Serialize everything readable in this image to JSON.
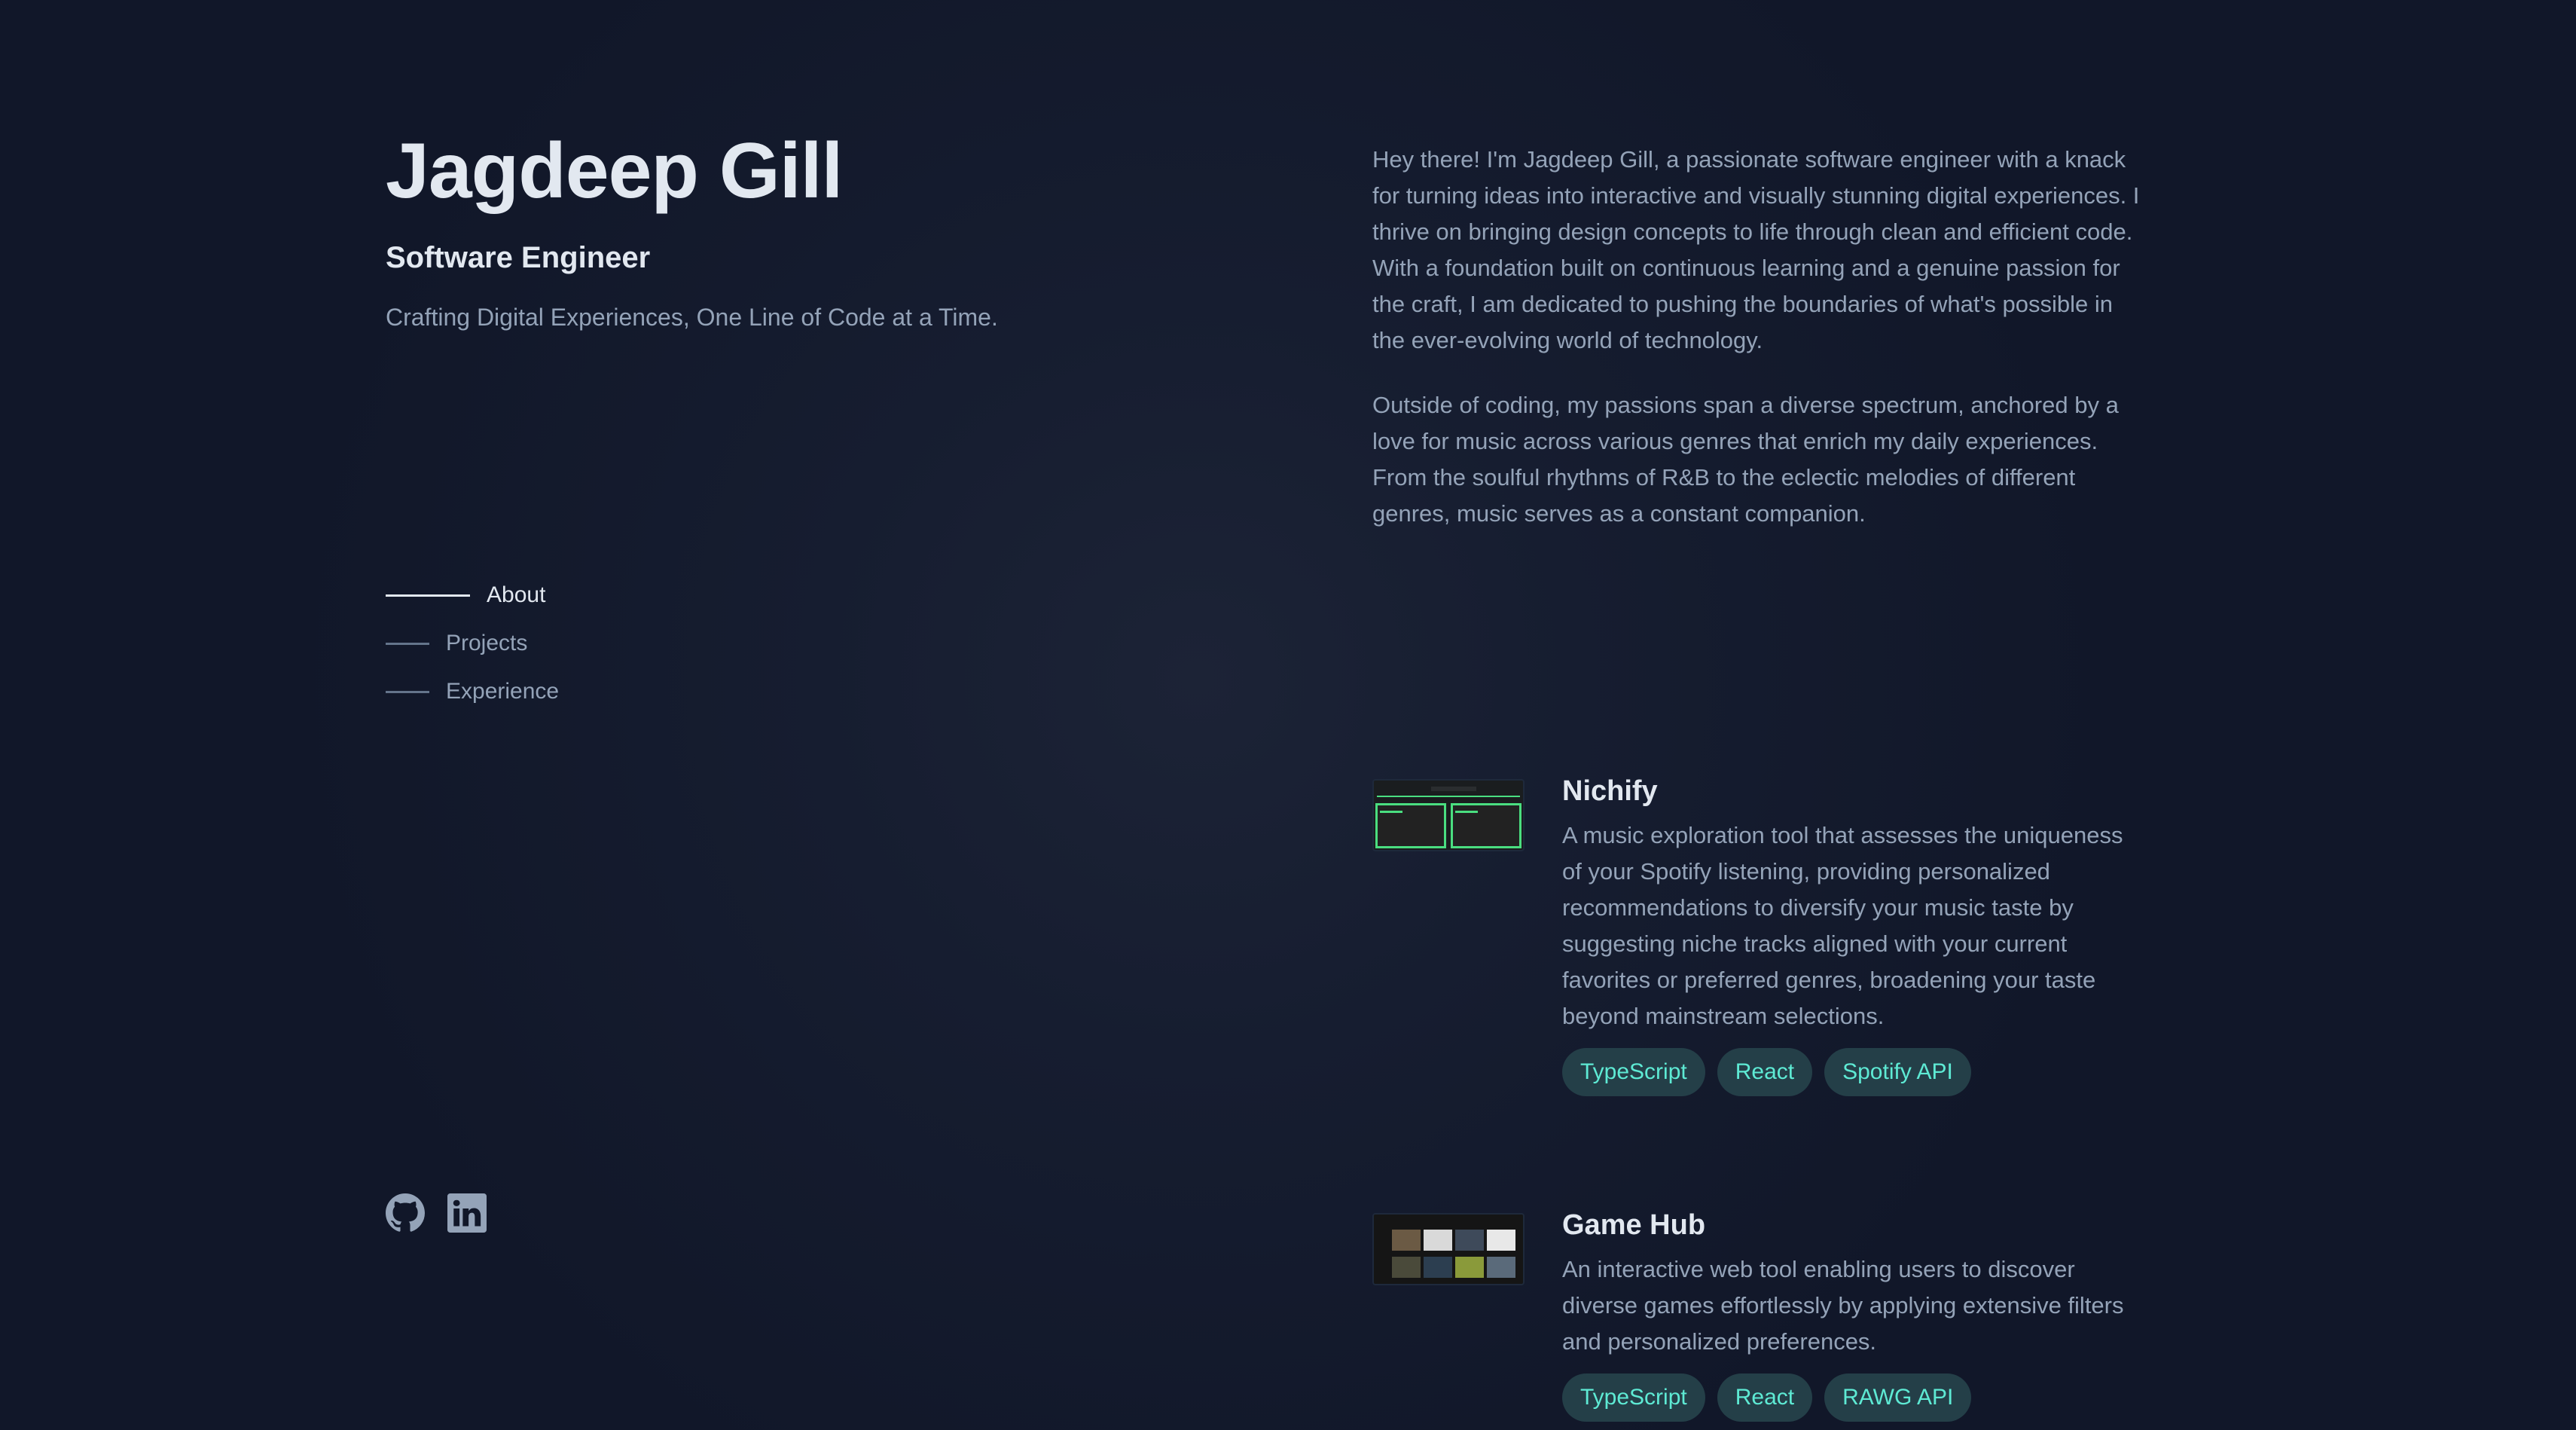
{
  "header": {
    "name": "Jagdeep Gill",
    "role": "Software Engineer",
    "tagline": "Crafting Digital Experiences, One Line of Code at a Time."
  },
  "nav": {
    "items": [
      {
        "label": "About",
        "active": true
      },
      {
        "label": "Projects",
        "active": false
      },
      {
        "label": "Experience",
        "active": false
      }
    ]
  },
  "socials": [
    {
      "icon": "github-icon"
    },
    {
      "icon": "linkedin-icon"
    }
  ],
  "about": {
    "paragraphs": [
      "Hey there! I'm Jagdeep Gill, a passionate software engineer with a knack for turning ideas into interactive and visually stunning digital experiences. I thrive on bringing design concepts to life through clean and efficient code. With a foundation built on continuous learning and a genuine passion for the craft, I am dedicated to pushing the boundaries of what's possible in the ever-evolving world of technology.",
      "Outside of coding, my passions span a diverse spectrum, anchored by a love for music across various genres that enrich my daily experiences. From the soulful rhythms of R&B to the eclectic melodies of different genres, music serves as a constant companion."
    ]
  },
  "projects": [
    {
      "title": "Nichify",
      "description": "A music exploration tool that assesses the uniqueness of your Spotify listening, providing personalized recommendations to diversify your music taste by suggesting niche tracks aligned with your current favorites or preferred genres, broadening your taste beyond mainstream selections.",
      "tags": [
        "TypeScript",
        "React",
        "Spotify API"
      ]
    },
    {
      "title": "Game Hub",
      "description": "An interactive web tool enabling users to discover diverse games effortlessly by applying extensive filters and personalized preferences.",
      "tags": [
        "TypeScript",
        "React",
        "RAWG API"
      ]
    }
  ],
  "colors": {
    "background": "#111729",
    "heading": "#e2e8f0",
    "body_text": "#94a3b8",
    "tag_text": "#5eead4",
    "tag_bg": "#243f48"
  }
}
